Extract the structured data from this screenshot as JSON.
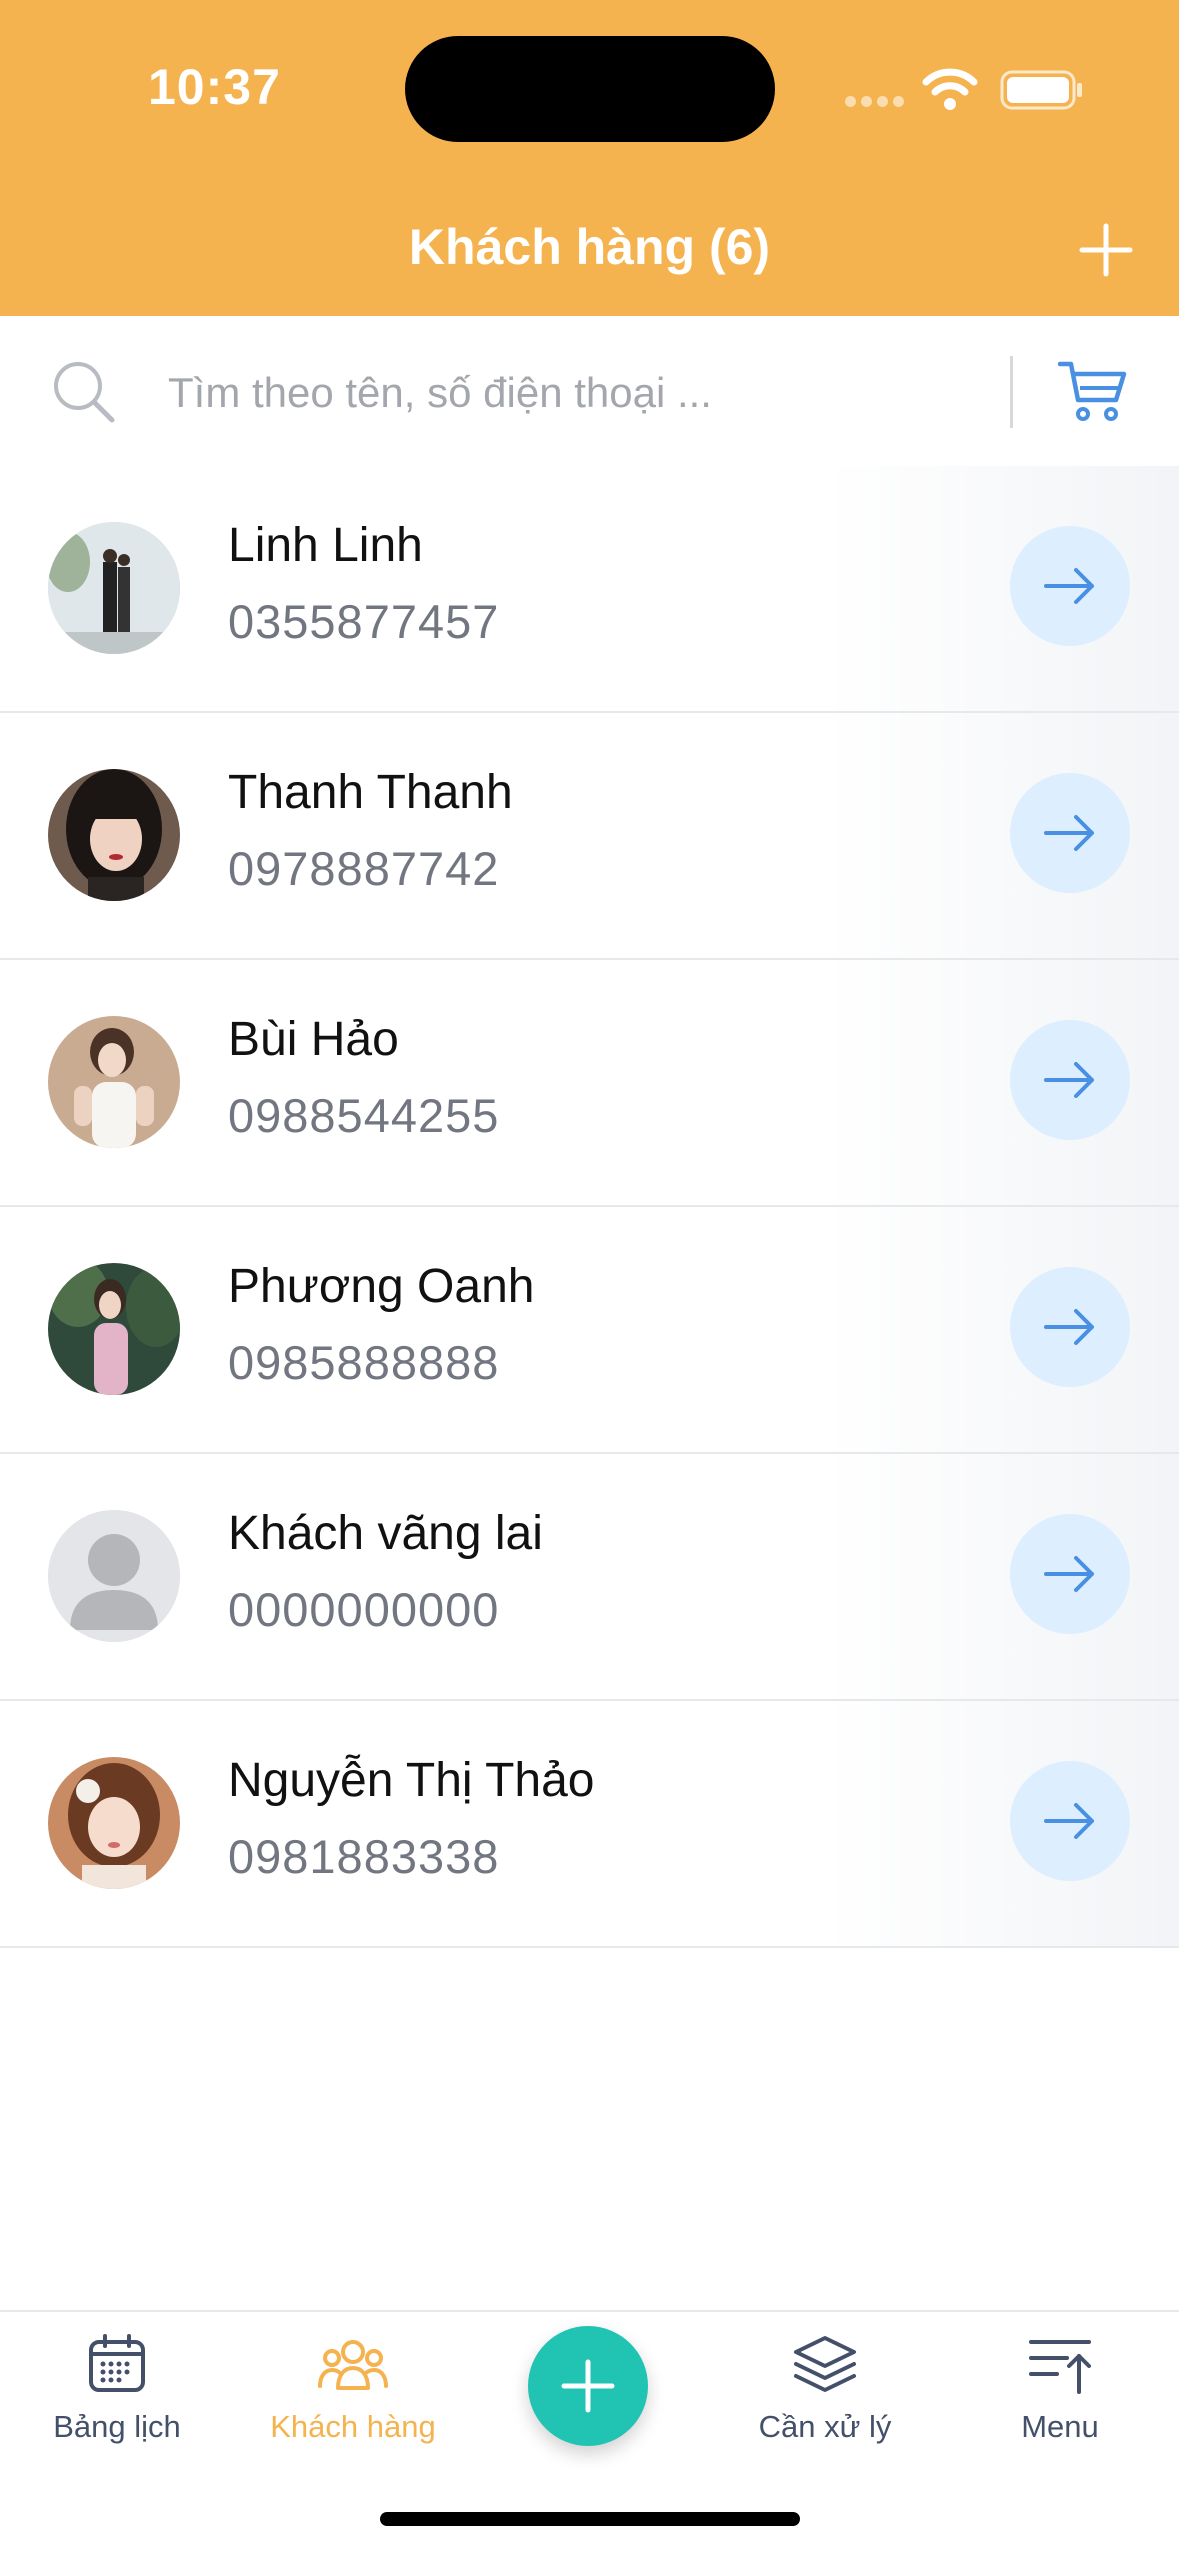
{
  "status_bar": {
    "time": "10:37"
  },
  "header": {
    "title": "Khách hàng (6)"
  },
  "search": {
    "placeholder": "Tìm theo tên, số điện thoại ..."
  },
  "customers": [
    {
      "name": "Linh Linh",
      "phone": "0355877457"
    },
    {
      "name": "Thanh Thanh",
      "phone": "0978887742"
    },
    {
      "name": "Bùi Hảo",
      "phone": "0988544255"
    },
    {
      "name": "Phương Oanh",
      "phone": "0985888888"
    },
    {
      "name": "Khách vãng lai",
      "phone": "0000000000"
    },
    {
      "name": "Nguyễn Thị Thảo",
      "phone": "0981883338"
    }
  ],
  "tabbar": {
    "calendar": "Bảng lịch",
    "customers": "Khách hàng",
    "todo": "Cần xử lý",
    "menu": "Menu"
  },
  "colors": {
    "header": "#F5B34F",
    "accent_blue": "#4A90E2",
    "fab": "#21C3B3",
    "arrow_bg": "#DDEEFF"
  }
}
